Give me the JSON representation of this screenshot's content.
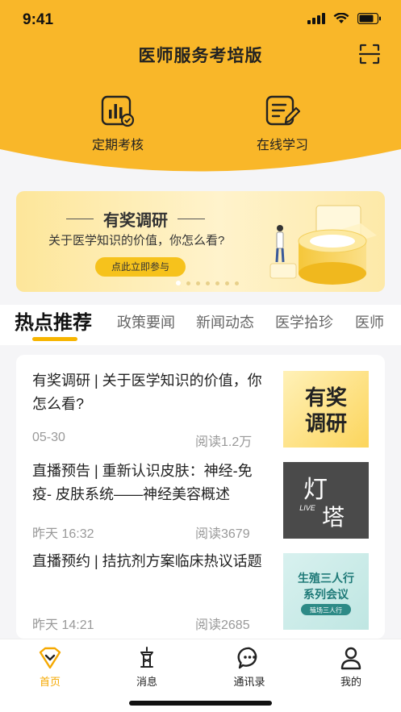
{
  "status_bar": {
    "time": "9:41"
  },
  "header": {
    "title": "医师服务考培版"
  },
  "quick_actions": [
    {
      "label": "定期考核",
      "icon": "chart-check-icon"
    },
    {
      "label": "在线学习",
      "icon": "document-edit-icon"
    }
  ],
  "banner": {
    "title": "有奖调研",
    "subtitle": "关于医学知识的价值，你怎么看?",
    "button": "点此立即参与",
    "page_count": 7,
    "active_page": 1
  },
  "tabs": [
    "热点推荐",
    "政策要闻",
    "新闻动态",
    "医学拾珍",
    "医师"
  ],
  "active_tab": 0,
  "news": [
    {
      "title": "有奖调研 | 关于医学知识的价值，你怎么看?",
      "date": "05-30",
      "reads": "阅读1.2万",
      "thumb_text": [
        "有奖",
        "调研"
      ]
    },
    {
      "title": "直播预告 | 重新认识皮肤：神经-免疫- 皮肤系统——神经美容概述",
      "date": "昨天 16:32",
      "reads": "阅读3679",
      "thumb_text": [
        "灯",
        "LIVE",
        "塔"
      ]
    },
    {
      "title": "直播预约 | 拮抗剂方案临床热议话题",
      "date": "昨天 14:21",
      "reads": "阅读2685",
      "thumb_text": [
        "生殖三人行",
        "系列会议",
        "殖场三人行"
      ]
    }
  ],
  "bottom_nav": [
    {
      "label": "首页",
      "icon": "home-icon"
    },
    {
      "label": "消息",
      "icon": "message-icon"
    },
    {
      "label": "通讯录",
      "icon": "chat-bubble-icon"
    },
    {
      "label": "我的",
      "icon": "user-icon"
    }
  ],
  "colors": {
    "accent": "#f9b729",
    "tab_underline": "#f7b500",
    "active_nav": "#f5a800"
  }
}
